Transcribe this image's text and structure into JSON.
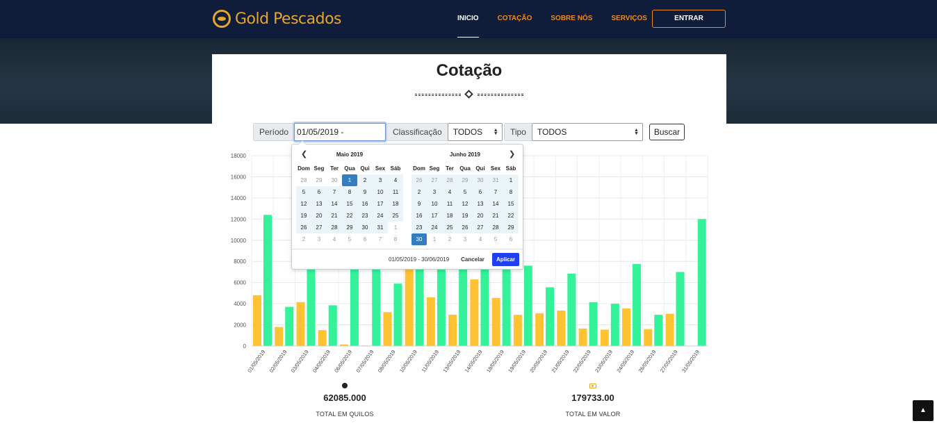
{
  "brand": {
    "name": "Gold Pescados"
  },
  "nav": {
    "items": [
      "INICIO",
      "COTAÇÃO",
      "SOBRE NÓS",
      "SERVIÇOS"
    ],
    "active": "INICIO",
    "login_label": "ENTRAR"
  },
  "page": {
    "title": "Cotação"
  },
  "filters": {
    "periodo_label": "Período",
    "periodo_value": "01/05/2019 - 30/06/2019",
    "classificacao_label": "Classificação",
    "classificacao_value": "TODOS",
    "tipo_label": "Tipo",
    "tipo_value": "TODOS",
    "buscar_label": "Buscar"
  },
  "datepicker": {
    "weekdays": [
      "Dom",
      "Seg",
      "Ter",
      "Qua",
      "Qui",
      "Sex",
      "Sáb"
    ],
    "left_month": "Maio 2019",
    "right_month": "Junho 2019",
    "left_days": [
      28,
      29,
      30,
      1,
      2,
      3,
      4,
      5,
      6,
      7,
      8,
      9,
      10,
      11,
      12,
      13,
      14,
      15,
      16,
      17,
      18,
      19,
      20,
      21,
      22,
      23,
      24,
      25,
      26,
      27,
      28,
      29,
      30,
      31,
      1,
      2,
      3,
      4,
      5,
      6,
      7,
      8
    ],
    "right_days": [
      26,
      27,
      28,
      29,
      30,
      31,
      1,
      2,
      3,
      4,
      5,
      6,
      7,
      8,
      9,
      10,
      11,
      12,
      13,
      14,
      15,
      16,
      17,
      18,
      19,
      20,
      21,
      22,
      23,
      24,
      25,
      26,
      27,
      28,
      29,
      30,
      1,
      2,
      3,
      4,
      5,
      6
    ],
    "selected_range": "01/05/2019 - 30/06/2019",
    "cancel_label": "Cancelar",
    "apply_label": "Aplicar"
  },
  "colors": {
    "series_quilos": "#ffc233",
    "series_valor": "#33f29a",
    "accent": "#f08a1c",
    "nav_bg": "#0f1c3a"
  },
  "chart_data": {
    "type": "bar",
    "categories": [
      "01/05/2019",
      "02/05/2019",
      "03/05/2019",
      "04/05/2019",
      "06/05/2019",
      "07/05/2019",
      "08/05/2019",
      "10/05/2019",
      "11/05/2019",
      "13/05/2019",
      "14/05/2019",
      "18/05/2019",
      "19/05/2019",
      "20/05/2019",
      "21/05/2019",
      "22/05/2019",
      "23/05/2019",
      "24/05/2019",
      "26/05/2019",
      "27/05/2019",
      "31/05/2019"
    ],
    "series": [
      {
        "values": [
          4800,
          1800,
          4150,
          1500,
          150,
          50,
          3200,
          7300,
          4600,
          2950,
          6300,
          4550,
          2950,
          3100,
          3350,
          1650,
          1550,
          3550,
          1600,
          3050,
          0
        ]
      },
      {
        "values": [
          12400,
          3700,
          7300,
          3850,
          7300,
          7300,
          5900,
          7300,
          7300,
          7300,
          7300,
          7300,
          7600,
          5550,
          6850,
          4150,
          4000,
          7750,
          2950,
          7000,
          12000
        ]
      }
    ],
    "ylim": [
      0,
      18000
    ],
    "yticks": [
      0,
      2000,
      4000,
      6000,
      8000,
      10000,
      12000,
      14000,
      16000,
      18000
    ],
    "grid": true
  },
  "totals": {
    "quilos_value": "62085.000",
    "quilos_label": "TOTAL EM QUILOS",
    "valor_value": "179733.00",
    "valor_label": "TOTAL EM VALOR"
  }
}
